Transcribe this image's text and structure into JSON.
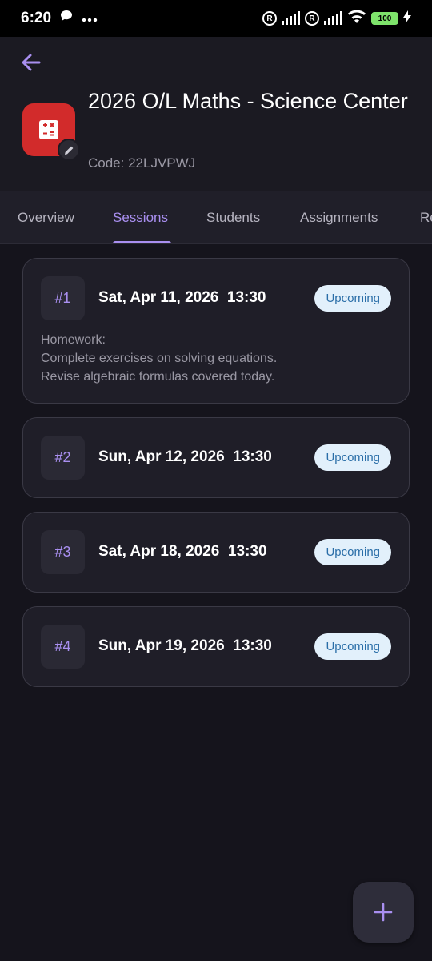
{
  "status_bar": {
    "time": "6:20",
    "battery": "100",
    "icons": [
      "chat-bubble-icon",
      "more-dots-icon",
      "registered-icon",
      "signal-icon",
      "wifi-icon",
      "battery-icon",
      "charging-icon"
    ]
  },
  "header": {
    "title": "2026 O/L Maths - Science Center",
    "code": "Code: 22LJVPWJ",
    "icon": "calculator-icon"
  },
  "tabs": [
    {
      "label": "Overview",
      "active": false
    },
    {
      "label": "Sessions",
      "active": true
    },
    {
      "label": "Students",
      "active": false
    },
    {
      "label": "Assignments",
      "active": false
    },
    {
      "label": "Re",
      "active": false
    }
  ],
  "sessions": [
    {
      "number": "#1",
      "date": "Sat, Apr 11, 2026  13:30",
      "status": "Upcoming",
      "notes": [
        "Homework:",
        "Complete exercises on solving equations.",
        "Revise algebraic formulas covered today."
      ]
    },
    {
      "number": "#2",
      "date": "Sun, Apr 12, 2026  13:30",
      "status": "Upcoming",
      "notes": []
    },
    {
      "number": "#3",
      "date": "Sat, Apr 18, 2026  13:30",
      "status": "Upcoming",
      "notes": []
    },
    {
      "number": "#4",
      "date": "Sun, Apr 19, 2026  13:30",
      "status": "Upcoming",
      "notes": []
    }
  ],
  "colors": {
    "accent": "#a98ff0",
    "background": "#15141c",
    "card": "#1f1e28",
    "pill_bg": "#e2f0fb",
    "pill_text": "#2a6ea8",
    "course_icon_bg": "#d22b2b"
  }
}
